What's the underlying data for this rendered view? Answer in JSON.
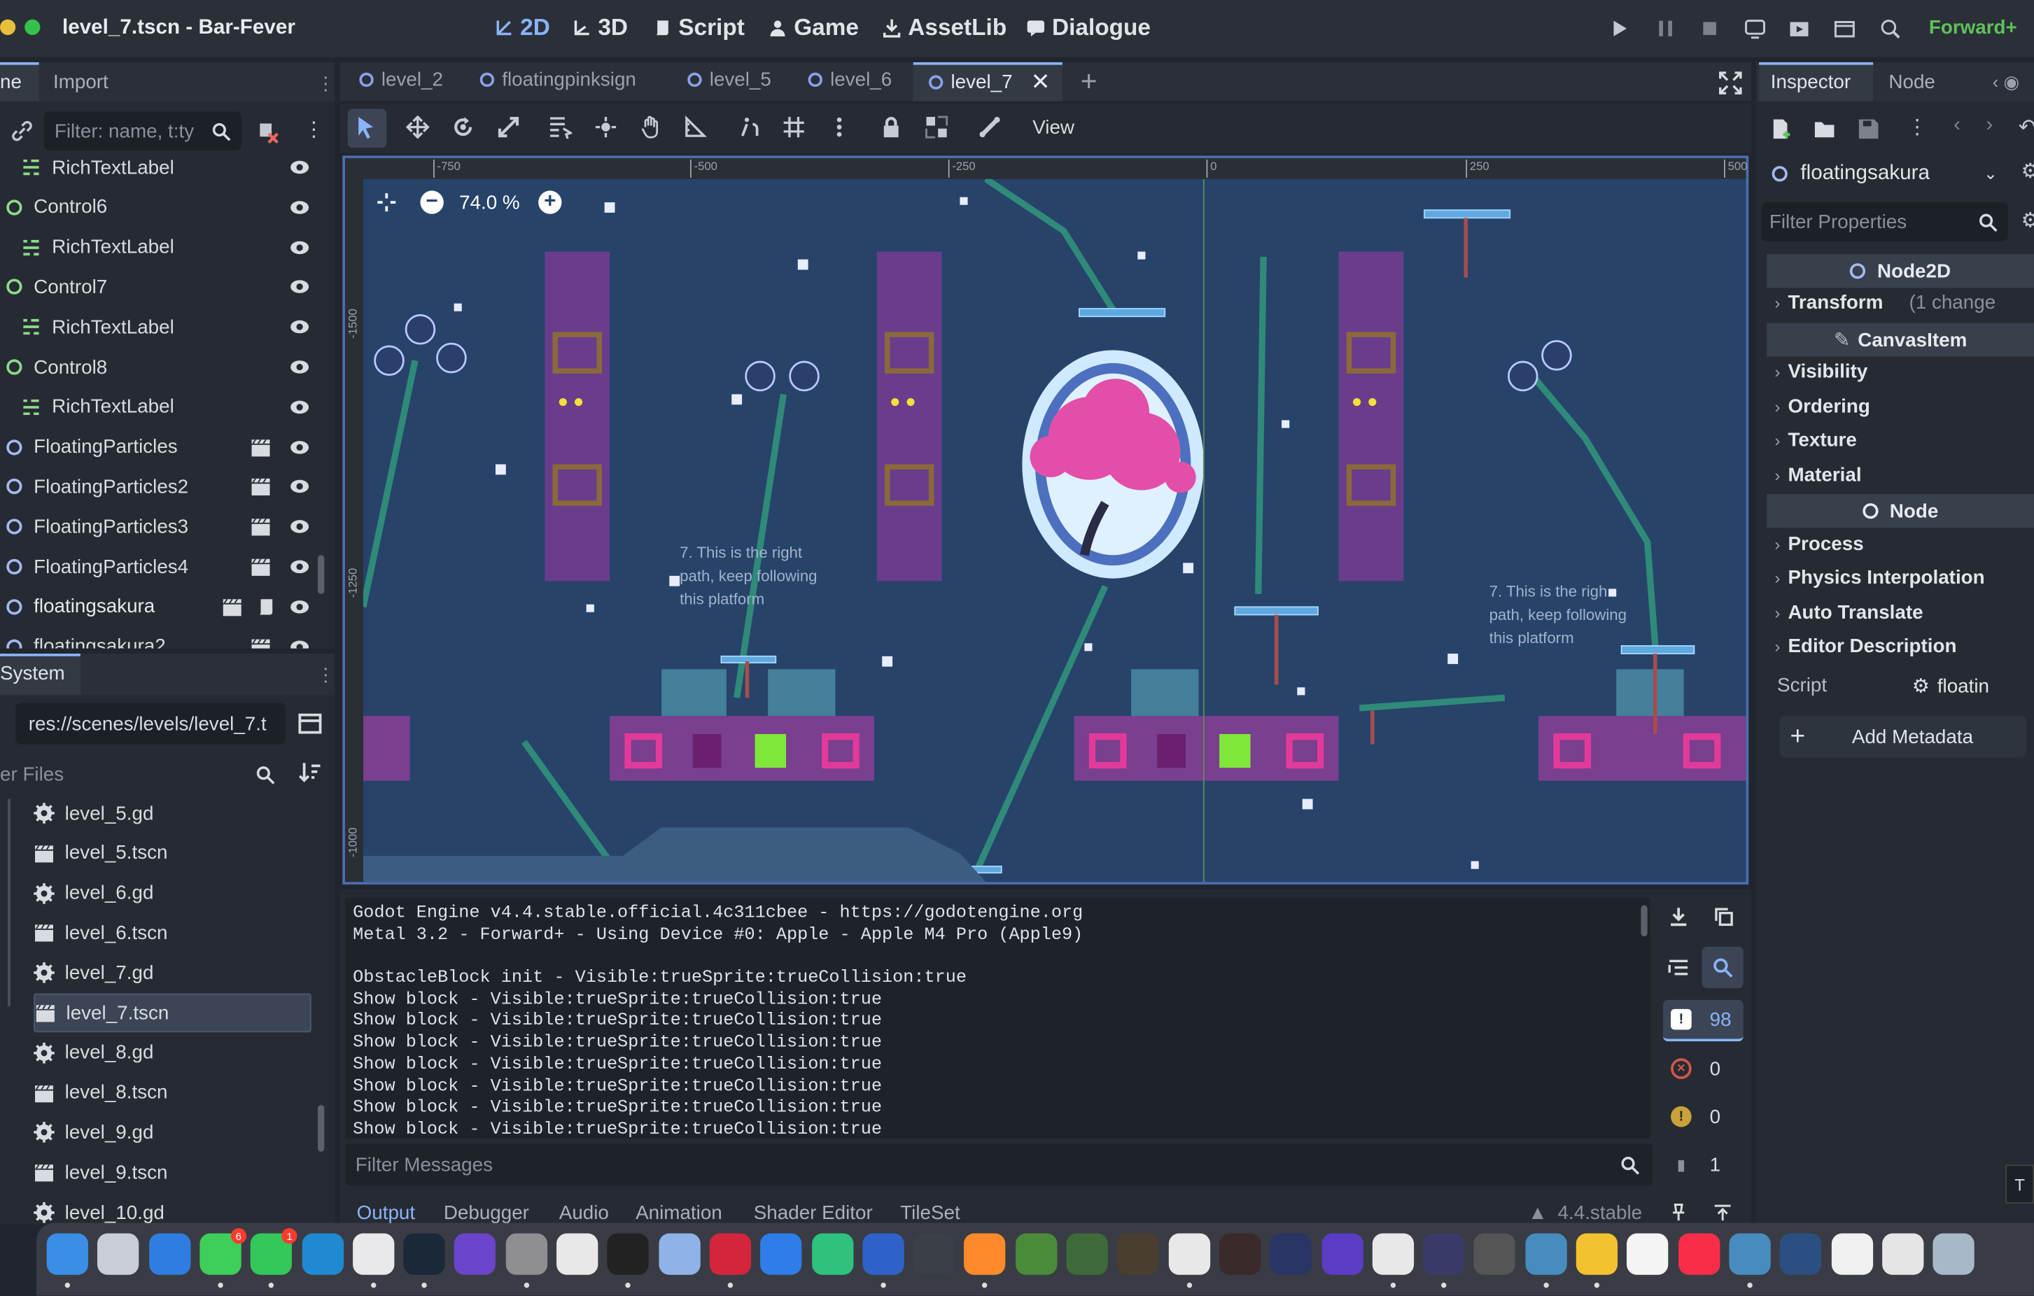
{
  "window": {
    "title": "level_7.tscn - Bar-Fever",
    "renderer": "Forward+"
  },
  "workspaces": [
    {
      "label": "2D",
      "icon": "2d-icon",
      "active": true
    },
    {
      "label": "3D",
      "icon": "3d-icon"
    },
    {
      "label": "Script",
      "icon": "script-icon"
    },
    {
      "label": "Game",
      "icon": "game-icon"
    },
    {
      "label": "AssetLib",
      "icon": "assetlib-icon"
    },
    {
      "label": "Dialogue",
      "icon": "dialogue-icon"
    }
  ],
  "scene_dock": {
    "tabs": [
      "ne",
      "Import"
    ],
    "filter_placeholder": "Filter: name, t:ty",
    "nodes": [
      {
        "label": "RichTextLabel",
        "type": "rich-text"
      },
      {
        "label": "Control6",
        "type": "control"
      },
      {
        "label": "RichTextLabel",
        "type": "rich-text"
      },
      {
        "label": "Control7",
        "type": "control"
      },
      {
        "label": "RichTextLabel",
        "type": "rich-text"
      },
      {
        "label": "Control8",
        "type": "control"
      },
      {
        "label": "RichTextLabel",
        "type": "rich-text"
      },
      {
        "label": "FloatingParticles",
        "type": "node2d"
      },
      {
        "label": "FloatingParticles2",
        "type": "node2d"
      },
      {
        "label": "FloatingParticles3",
        "type": "node2d"
      },
      {
        "label": "FloatingParticles4",
        "type": "node2d"
      },
      {
        "label": "floatingsakura",
        "type": "node2d",
        "selected": true
      },
      {
        "label": "floatingsakura2",
        "type": "node2d"
      }
    ]
  },
  "filesystem": {
    "tab": "System",
    "path": "res://scenes/levels/level_7.t",
    "filter_placeholder": "er Files",
    "files": [
      {
        "name": "level_5.gd",
        "kind": "script"
      },
      {
        "name": "level_5.tscn",
        "kind": "scene"
      },
      {
        "name": "level_6.gd",
        "kind": "script"
      },
      {
        "name": "level_6.tscn",
        "kind": "scene"
      },
      {
        "name": "level_7.gd",
        "kind": "script"
      },
      {
        "name": "level_7.tscn",
        "kind": "scene",
        "selected": true
      },
      {
        "name": "level_8.gd",
        "kind": "script"
      },
      {
        "name": "level_8.tscn",
        "kind": "scene"
      },
      {
        "name": "level_9.gd",
        "kind": "script"
      },
      {
        "name": "level_9.tscn",
        "kind": "scene"
      },
      {
        "name": "level_10.gd",
        "kind": "script"
      }
    ]
  },
  "editor": {
    "tabs": [
      "level_2",
      "floatingpinksign",
      "level_5",
      "level_6",
      "level_7"
    ],
    "active_tab": "level_7",
    "view_label": "View",
    "zoom": "74.0 %",
    "ruler_marks": [
      "-750",
      "-500",
      "-250",
      "0",
      "250",
      "500"
    ],
    "ruler_v": [
      "-1500",
      "-1250",
      "-1000"
    ],
    "canvas_texts": [
      "7. This is the right path, keep following this platform",
      "7. This is the righ path, keep following this platform"
    ]
  },
  "inspector": {
    "tabs": [
      "Inspector",
      "Node"
    ],
    "node_name": "floatingsakura",
    "filter_placeholder": "Filter Properties",
    "sections": [
      {
        "kind": "header",
        "label": "Node2D",
        "icon": "node2d-icon"
      },
      {
        "kind": "prop",
        "label": "Transform",
        "note": "(1 change"
      },
      {
        "kind": "header",
        "label": "CanvasItem",
        "icon": "brush-icon"
      },
      {
        "kind": "prop",
        "label": "Visibility"
      },
      {
        "kind": "prop",
        "label": "Ordering"
      },
      {
        "kind": "prop",
        "label": "Texture"
      },
      {
        "kind": "prop",
        "label": "Material"
      },
      {
        "kind": "header",
        "label": "Node",
        "icon": "node-icon"
      },
      {
        "kind": "prop",
        "label": "Process"
      },
      {
        "kind": "prop",
        "label": "Physics Interpolation"
      },
      {
        "kind": "prop",
        "label": "Auto Translate"
      },
      {
        "kind": "prop",
        "label": "Editor Description"
      }
    ],
    "script_label": "Script",
    "script_value": "floatin",
    "add_metadata": "Add Metadata"
  },
  "output": {
    "lines": [
      "Godot Engine v4.4.stable.official.4c311cbee - https://godotengine.org",
      "Metal 3.2 - Forward+ - Using Device #0: Apple - Apple M4 Pro (Apple9)",
      "",
      "ObstacleBlock init - Visible:trueSprite:trueCollision:true",
      "Show block - Visible:trueSprite:trueCollision:true",
      "Show block - Visible:trueSprite:trueCollision:true",
      "Show block - Visible:trueSprite:trueCollision:true",
      "Show block - Visible:trueSprite:trueCollision:true",
      "Show block - Visible:trueSprite:trueCollision:true",
      "Show block - Visible:trueSprite:trueCollision:true",
      "Show block - Visible:trueSprite:trueCollision:true"
    ],
    "filter_placeholder": "Filter Messages",
    "counts": {
      "messages": "98",
      "errors": "0",
      "warnings": "0",
      "other": "1"
    }
  },
  "bottom_tabs": [
    "Output",
    "Debugger",
    "Audio",
    "Animation",
    "Shader Editor",
    "TileSet"
  ],
  "version": "4.4.stable",
  "dock_badges": {
    "messages": "6",
    "facetime": "1"
  }
}
